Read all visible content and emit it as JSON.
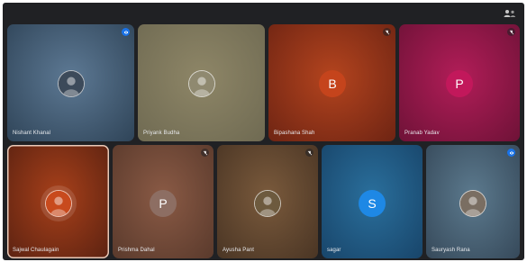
{
  "participants": [
    {
      "name": "Nishant Khanal",
      "initial": "",
      "badge": "speaking",
      "avatar_color": "#3c4a5a",
      "bg_a": "#5d7994",
      "bg_b": "#2f4458",
      "photo": true
    },
    {
      "name": "Priyank Budha",
      "initial": "",
      "badge": "",
      "avatar_color": "#8f8970",
      "bg_a": "#8e8667",
      "bg_b": "#6f6a52",
      "photo": true
    },
    {
      "name": "Bipashana Shah",
      "initial": "B",
      "badge": "muted",
      "avatar_color": "#c5441c",
      "bg_a": "#b4441e",
      "bg_b": "#6e2413",
      "photo": false
    },
    {
      "name": "Pranab Yadav",
      "initial": "P",
      "badge": "muted",
      "avatar_color": "#c2185b",
      "bg_a": "#b21d58",
      "bg_b": "#6e1237",
      "photo": false
    },
    {
      "name": "Sajwal Chaulagain",
      "initial": "",
      "badge": "",
      "avatar_color": "#c84a1d",
      "bg_a": "#a8401a",
      "bg_b": "#5b2211",
      "photo": true
    },
    {
      "name": "Prishma Dahal",
      "initial": "P",
      "badge": "muted",
      "avatar_color": "#8d6e63",
      "bg_a": "#8a5a45",
      "bg_b": "#5a3a2c",
      "photo": false
    },
    {
      "name": "Ayusha Pant",
      "initial": "",
      "badge": "muted",
      "avatar_color": "#6d5a3e",
      "bg_a": "#7a5a3c",
      "bg_b": "#4a3524",
      "photo": true
    },
    {
      "name": "sagar",
      "initial": "S",
      "badge": "",
      "avatar_color": "#1e88e5",
      "bg_a": "#2a6f9c",
      "bg_b": "#18456a",
      "photo": false
    },
    {
      "name": "Sauryash Rana",
      "initial": "",
      "badge": "speaking",
      "avatar_color": "#7a6e62",
      "bg_a": "#5c7a8e",
      "bg_b": "#36495a",
      "photo": true
    }
  ],
  "selected_participant": "Sajwal Chaulagain",
  "topbar": {
    "icon": "people-icon"
  }
}
